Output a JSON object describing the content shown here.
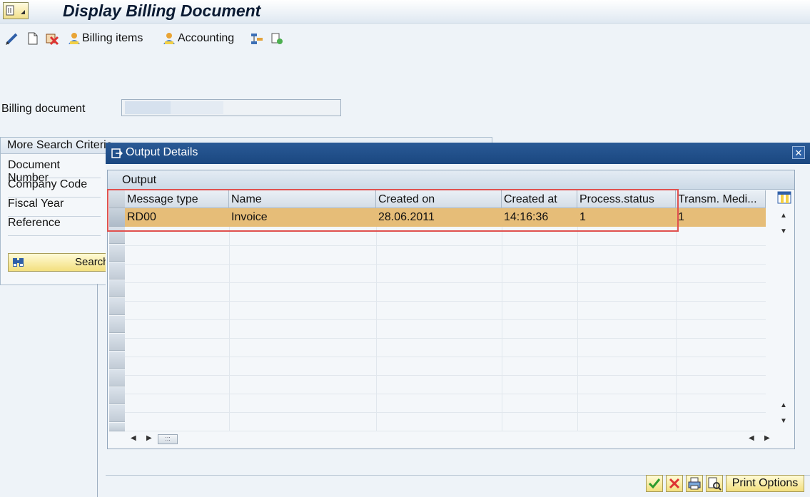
{
  "window": {
    "title": "Display Billing Document"
  },
  "toolbar": {
    "billing_items": "Billing items",
    "accounting": "Accounting"
  },
  "billing_document": {
    "label": "Billing document",
    "value": ""
  },
  "search_panel": {
    "title": "More Search Criteria",
    "criteria": [
      "Document Number",
      "Company Code",
      "Fiscal Year",
      "Reference"
    ],
    "search_button": "Search"
  },
  "dialog": {
    "title": "Output Details",
    "section_title": "Output",
    "columns": [
      "Message type",
      "Name",
      "Created on",
      "Created at",
      "Process.status",
      "Transm. Medi..."
    ],
    "rows": [
      {
        "message_type": "RD00",
        "name": "Invoice",
        "created_on": "28.06.2011",
        "created_at": "14:16:36",
        "process_status": "1",
        "transm_medium": "1"
      }
    ],
    "print_options": "Print Options"
  },
  "colors": {
    "selected_row": "#e6bd78",
    "highlight_box": "#e0504e",
    "dialog_titlebar": "#1f4f8b"
  }
}
